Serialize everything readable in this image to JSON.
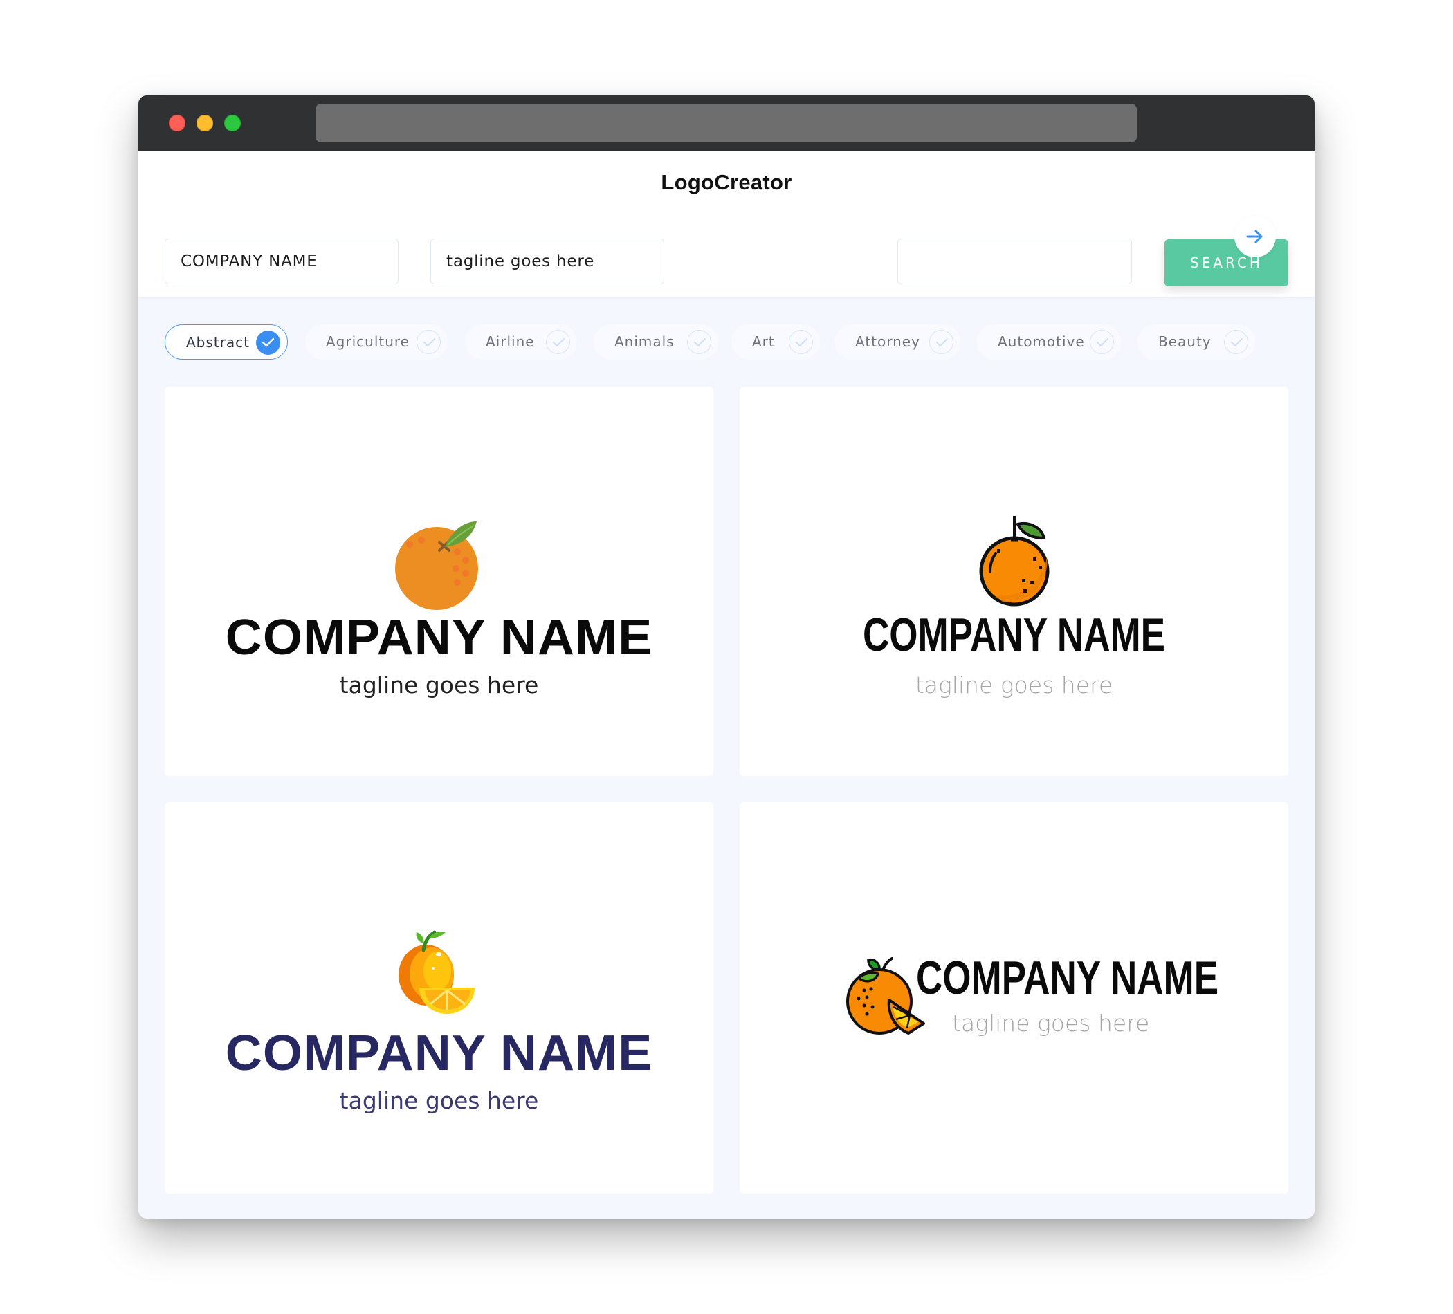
{
  "app": {
    "brand": "LogoCreator"
  },
  "search": {
    "company_value": "COMPANY NAME",
    "tagline_value": "tagline goes here",
    "keyword_value": "",
    "button_label": "SEARCH"
  },
  "categories": {
    "items": [
      {
        "label": "Abstract",
        "selected": true
      },
      {
        "label": "Agriculture",
        "selected": false
      },
      {
        "label": "Airline",
        "selected": false
      },
      {
        "label": "Animals",
        "selected": false
      },
      {
        "label": "Art",
        "selected": false
      },
      {
        "label": "Attorney",
        "selected": false
      },
      {
        "label": "Automotive",
        "selected": false
      },
      {
        "label": "Beauty",
        "selected": false
      }
    ],
    "next_icon": "arrow-right-icon"
  },
  "colors": {
    "accent_blue": "#3a8ef1",
    "search_green": "#58c9a1",
    "orange": "#ec8e22",
    "navy": "#272762"
  },
  "logos": [
    {
      "company": "COMPANY NAME",
      "tagline": "tagline goes here",
      "icon": "orange-with-leaf-icon",
      "layout": "stacked"
    },
    {
      "company": "COMPANY NAME",
      "tagline": "tagline goes here",
      "icon": "outlined-orange-icon",
      "layout": "stacked"
    },
    {
      "company": "COMPANY NAME",
      "tagline": "tagline goes here",
      "icon": "orange-with-slice-icon",
      "layout": "stacked"
    },
    {
      "company": "COMPANY NAME",
      "tagline": "tagline goes here",
      "icon": "outlined-orange-slice-icon",
      "layout": "inline"
    }
  ]
}
